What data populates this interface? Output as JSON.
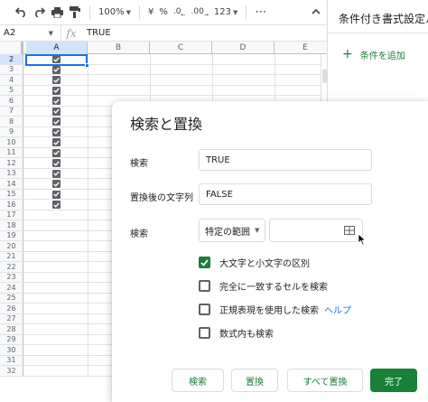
{
  "toolbar": {
    "zoom": "100%",
    "currency": "¥",
    "percent": "%",
    "decrease_decimal": ".0",
    "increase_decimal": ".00",
    "more_formats": "123"
  },
  "formula_bar": {
    "name_box": "A2",
    "fx": "fx",
    "value": "TRUE"
  },
  "grid": {
    "columns": [
      "A",
      "B",
      "C",
      "D",
      "E"
    ],
    "rows": [
      "2",
      "3",
      "4",
      "5",
      "6",
      "7",
      "8",
      "9",
      "10",
      "11",
      "12",
      "13",
      "14",
      "15",
      "16",
      "17",
      "18",
      "19",
      "20",
      "21",
      "22",
      "23",
      "24",
      "25",
      "26",
      "27",
      "28",
      "29",
      "30",
      "31",
      "32"
    ],
    "checked_rows": 15
  },
  "side_panel": {
    "title": "条件付き書式設定ル",
    "add_rule": "条件を追加"
  },
  "dialog": {
    "title": "検索と置換",
    "find_label": "検索",
    "find_value": "TRUE",
    "replace_label": "置換後の文字列",
    "replace_value": "FALSE",
    "search_label": "検索",
    "search_scope": "特定の範囲",
    "range_value": "",
    "options": {
      "match_case": "大文字と小文字の区別",
      "match_entire": "完全に一致するセルを検索",
      "regex": "正規表現を使用した検索",
      "help": "ヘルプ",
      "within_formulas": "数式内も検索"
    },
    "match_case_checked": true,
    "buttons": {
      "find": "検索",
      "replace": "置換",
      "replace_all": "すべて置換",
      "done": "完了"
    }
  },
  "colors": {
    "accent_green": "#188038",
    "selection_blue": "#1a73e8"
  }
}
